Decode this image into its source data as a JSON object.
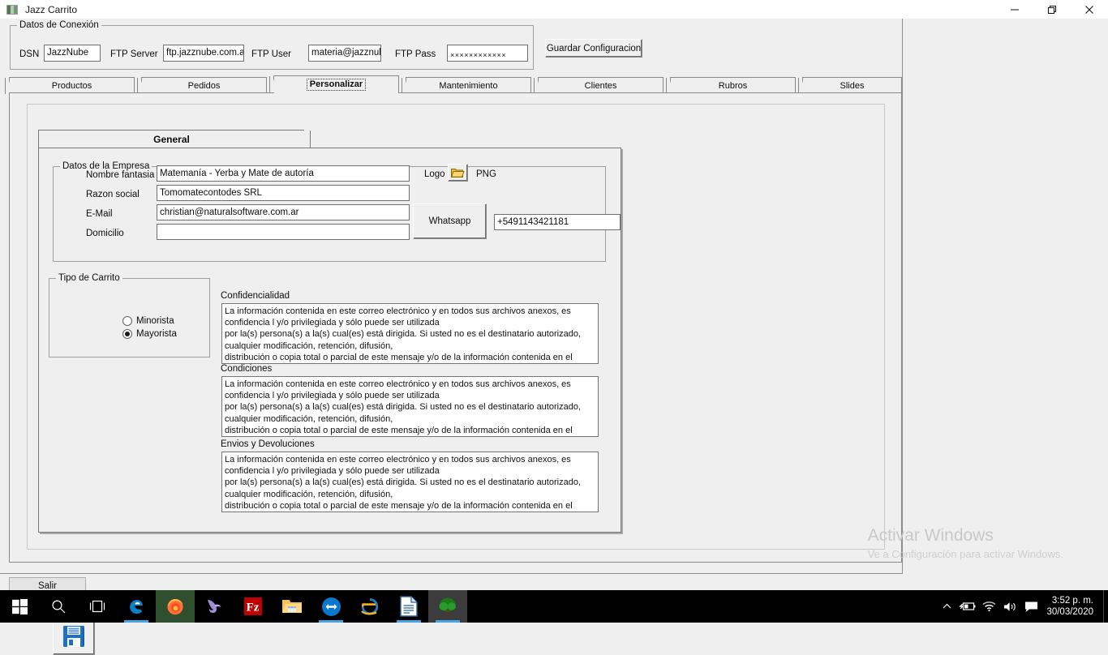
{
  "window": {
    "title": "Jazz Carrito",
    "icon": "app-bars-icon",
    "controls": {
      "minimize": "minimize-icon",
      "maximize": "restore-icon",
      "close": "close-icon"
    }
  },
  "connection": {
    "group_title": "Datos de Conexión",
    "fields": [
      {
        "label": "DSN",
        "value": "JazzNube"
      },
      {
        "label": "FTP Server",
        "value": "ftp.jazznube.com.ar"
      },
      {
        "label": "FTP User",
        "value": "materia@jazznube"
      },
      {
        "label": "FTP Pass",
        "value": "××××××××××××"
      }
    ],
    "save_button": "Guardar Configuracion"
  },
  "tabs": {
    "items": [
      {
        "label": "Productos",
        "selected": false
      },
      {
        "label": "Pedidos",
        "selected": false
      },
      {
        "label": "Personalizar",
        "selected": true
      },
      {
        "label": "Mantenimiento",
        "selected": false
      },
      {
        "label": "Clientes",
        "selected": false
      },
      {
        "label": "Rubros",
        "selected": false
      },
      {
        "label": "Slides",
        "selected": false
      }
    ]
  },
  "subtab": {
    "label": "General"
  },
  "empresa": {
    "group_title": "Datos de la Empresa",
    "nombre_fantasia_label": "Nombre fantasia",
    "nombre_fantasia_value": "Matemanía - Yerba y Mate de autoría",
    "razon_social_label": "Razon social",
    "razon_social_value": "Tomomatecontodes SRL",
    "email_label": "E-Mail",
    "email_value": "christian@naturalsoftware.com.ar",
    "domicilio_label": "Domicilio",
    "domicilio_value": "",
    "logo_label": "Logo",
    "logo_icon": "folder-icon",
    "logo_format": "PNG",
    "whatsapp_button": "Whatsapp",
    "whatsapp_value": "+5491143421181"
  },
  "tipo_carrito": {
    "group_title": "Tipo de Carrito",
    "options": [
      {
        "label": "Minorista",
        "selected": false
      },
      {
        "label": "Mayorista",
        "selected": true
      }
    ]
  },
  "legal_text": "La información contenida en este correo electrónico y en todos sus archivos anexos, es\nconfidencia l y/o privilegiada y sólo puede ser utilizada\npor la(s) persona(s) a la(s) cual(es) está dirigida. Si usted no es el destinatario autorizado,\ncualquier modificación, retención, difusión,\ndistribución o copia total o parcial de este mensaje y/o de la información contenida en el mismo",
  "sections": {
    "confidencialidad_label": "Confidencialidad",
    "condiciones_label": "Condiciones",
    "envios_label": "Envios y Devoluciones"
  },
  "footer": {
    "save_icon": "floppy-disk-icon",
    "exit_button": "Salir"
  },
  "watermark": {
    "title": "Activar Windows",
    "subtitle": "Ve a Configuración para activar Windows."
  },
  "taskbar": {
    "items": [
      {
        "name": "start-button",
        "icon": "windows-logo-icon"
      },
      {
        "name": "search-button",
        "icon": "search-icon"
      },
      {
        "name": "task-view-button",
        "icon": "task-view-icon"
      },
      {
        "name": "edge-legacy-button",
        "icon": "edge-icon"
      },
      {
        "name": "firefox-button",
        "icon": "firefox-icon"
      },
      {
        "name": "dolphin-button",
        "icon": "dolphin-icon"
      },
      {
        "name": "filezilla-button",
        "icon": "filezilla-icon"
      },
      {
        "name": "file-explorer-button",
        "icon": "folder-icon"
      },
      {
        "name": "teamviewer-button",
        "icon": "teamviewer-icon"
      },
      {
        "name": "internet-explorer-button",
        "icon": "internet-explorer-icon"
      },
      {
        "name": "libreoffice-writer-button",
        "icon": "document-icon"
      },
      {
        "name": "jazz-carrito-button",
        "icon": "tree-icon"
      }
    ],
    "tray": {
      "chevron": "show-hidden-icons-icon",
      "battery": "battery-charging-icon",
      "network": "wifi-icon",
      "volume": "speaker-icon",
      "action_center": "notifications-icon"
    },
    "clock": {
      "time": "3:52 p. m.",
      "date": "30/03/2020"
    }
  }
}
